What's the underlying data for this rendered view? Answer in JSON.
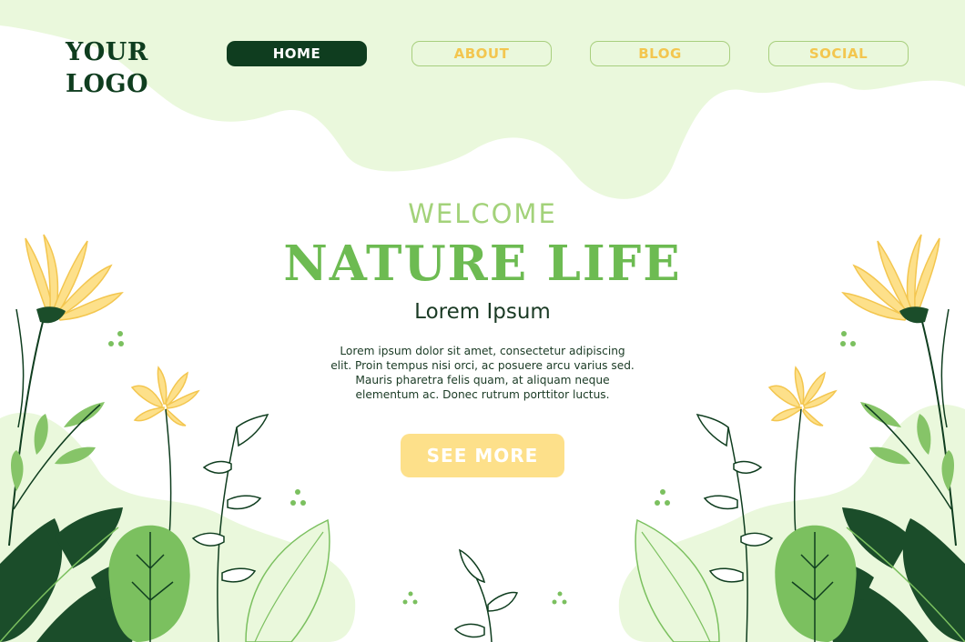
{
  "logo": {
    "line1": "YOUR",
    "line2": "LOGO"
  },
  "nav": {
    "home": "HOME",
    "about": "ABOUT",
    "blog": "BLOG",
    "social": "SOCIAL"
  },
  "hero": {
    "welcome": "WELCOME",
    "title": "NATURE LIFE",
    "subtitle": "Lorem Ipsum",
    "body": [
      "Lorem ipsum dolor sit amet, consectetur adipiscing",
      "elit. Proin tempus nisi orci, ac posuere arcu varius sed.",
      "Mauris pharetra felis quam, at aliquam neque",
      "elementum ac. Donec rutrum porttitor luctus."
    ],
    "cta": "SEE MORE"
  },
  "colors": {
    "dark_green": "#0f3d1f",
    "mid_green": "#6dbb52",
    "light_green": "#a3d27a",
    "pale_green": "#e9f7dc",
    "yellow": "#fde08a",
    "yellow_text": "#f3c64f"
  },
  "icons": [
    "yellow-flower-icon",
    "leaf-icon",
    "fern-icon",
    "monstera-leaf-icon",
    "dots-icon"
  ]
}
